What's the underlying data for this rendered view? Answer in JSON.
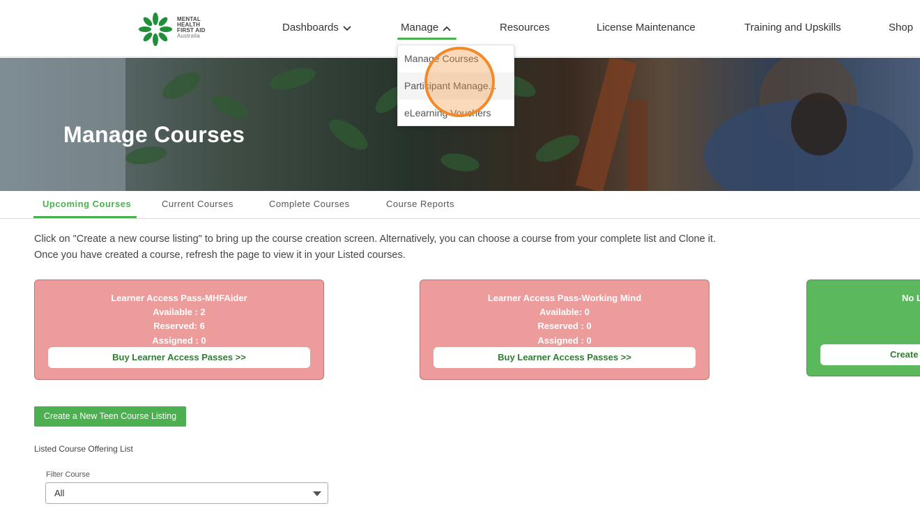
{
  "brand": {
    "logo_line1": "MENTAL",
    "logo_line2": "HEALTH",
    "logo_line3": "FIRST AID",
    "logo_line4": "Australia",
    "logo_color": "#1f8f3a"
  },
  "nav": {
    "items": [
      {
        "label": "Dashboards"
      },
      {
        "label": "Manage"
      },
      {
        "label": "Resources"
      },
      {
        "label": "License Maintenance"
      },
      {
        "label": "Training and Upskills"
      },
      {
        "label": "Shop"
      }
    ],
    "accent": "#4caf50"
  },
  "dropdown": {
    "items": [
      {
        "label": "Manage Courses"
      },
      {
        "label": "Participant Manage..."
      },
      {
        "label": "eLearning Vouchers"
      }
    ]
  },
  "hero": {
    "title": "Manage Courses"
  },
  "tabs": [
    {
      "label": "Upcoming Courses",
      "active": true
    },
    {
      "label": "Current Courses"
    },
    {
      "label": "Complete Courses"
    },
    {
      "label": "Course Reports"
    }
  ],
  "instructions": {
    "line1": "Click on \"Create a new course listing\" to bring up the course creation screen. Alternatively, you can choose a course from your complete list and Clone it.",
    "line2": "Once you have created a course, refresh the page to view it in your Listed courses."
  },
  "cards": [
    {
      "title": "Learner Access Pass-MHFAider",
      "available": "Available : 2",
      "reserved": "Reserved: 6",
      "assigned": "Assigned : 0",
      "button": "Buy Learner Access Passes >>",
      "color": "#eb9c9b"
    },
    {
      "title": "Learner Access Pass-Working Mind",
      "available": "Available: 0",
      "reserved": "Reserved : 0",
      "assigned": "Assigned : 0",
      "button": "Buy Learner Access Passes >>",
      "color": "#eb9c9b"
    },
    {
      "title": "No L",
      "button": "Create",
      "color": "#5bb85c"
    }
  ],
  "teen_button": "Create a New Teen Course Listing",
  "listed_label": "Listed Course Offering List",
  "filter": {
    "label": "Filter Course",
    "value": "All"
  }
}
